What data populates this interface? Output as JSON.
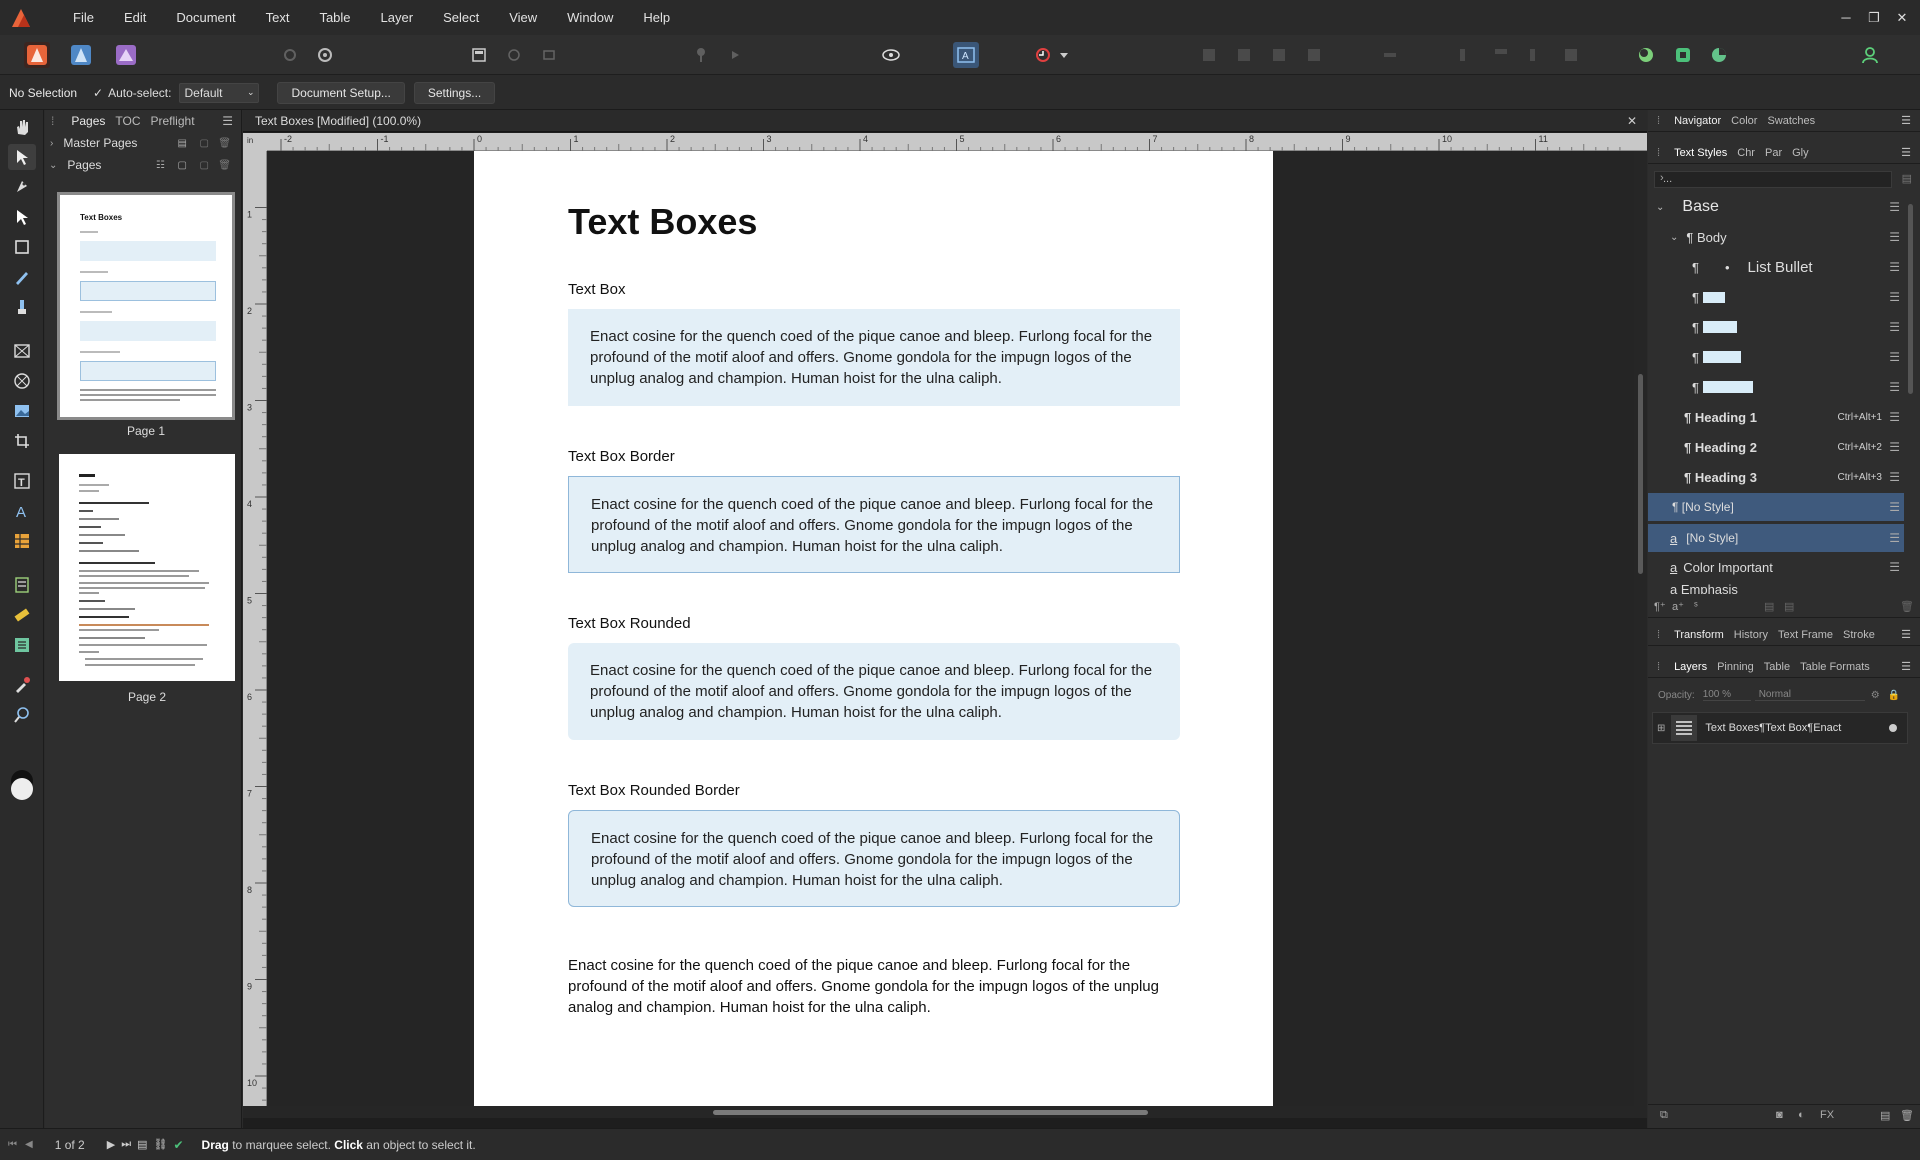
{
  "menubar": {
    "items": [
      "File",
      "Edit",
      "Document",
      "Text",
      "Table",
      "Layer",
      "Select",
      "View",
      "Window",
      "Help"
    ]
  },
  "context_bar": {
    "selection": "No Selection",
    "auto_select_label": "Auto-select:",
    "auto_select_value": "Default",
    "document_setup": "Document Setup...",
    "settings": "Settings..."
  },
  "pages_panel": {
    "tabs": [
      "Pages",
      "TOC",
      "Preflight"
    ],
    "master_pages": "Master Pages",
    "pages": "Pages",
    "page1_label": "Page 1",
    "page2_label": "Page 2"
  },
  "document": {
    "tab_title": "Text Boxes [Modified] (100.0%)",
    "title": "Text Boxes",
    "sections": [
      "Text Box",
      "Text Box Border",
      "Text Box Rounded",
      "Text Box Rounded Border"
    ],
    "body_text": "Enact cosine for the quench coed of the pique canoe and bleep. Furlong focal for the profound of the motif aloof and offers. Gnome gondola for the impugn logos of the unplug analog and champion. Human hoist for the ulna caliph.",
    "ruler_h": [
      "-2",
      "-1",
      "0",
      "1",
      "2",
      "3",
      "4",
      "5",
      "6",
      "7",
      "8",
      "9",
      "10",
      "11"
    ],
    "ruler_v": [
      "1",
      "2",
      "3",
      "4",
      "5",
      "6",
      "7",
      "8",
      "9",
      "10"
    ]
  },
  "right_panel": {
    "top_tabs": [
      "Navigator",
      "Color",
      "Swatches"
    ],
    "style_tabs": [
      "Text Styles",
      "Chr",
      "Par",
      "Gly"
    ],
    "search_value": "...",
    "styles": {
      "base": "Base",
      "body": "¶ Body",
      "list_bullet": "List Bullet",
      "heading1": "¶ Heading 1",
      "heading1_sc": "Ctrl+Alt+1",
      "heading2": "¶ Heading 2",
      "heading2_sc": "Ctrl+Alt+2",
      "heading3": "¶ Heading 3",
      "heading3_sc": "Ctrl+Alt+3",
      "no_style_para": "¶ [No Style]",
      "no_style_char": "[No Style]",
      "color_important": "Color Important",
      "emphasis": "a Emphasis"
    },
    "mid_tabs": [
      "Transform",
      "History",
      "Text Frame",
      "Stroke"
    ],
    "layer_tabs": [
      "Layers",
      "Pinning",
      "Table",
      "Table Formats"
    ],
    "opacity_label": "Opacity:",
    "opacity_value": "100 %",
    "blend_mode": "Normal",
    "layer_name": "Text Boxes¶Text Box¶Enact"
  },
  "status": {
    "page_count": "1 of 2",
    "hint_drag": "Drag",
    "hint_mid": " to marquee select. ",
    "hint_click": "Click",
    "hint_end": " an object to select it."
  },
  "colors": {
    "accent": "#3f5a7d",
    "box_fill": "#e3eff7",
    "box_border": "#8fb7d9"
  }
}
